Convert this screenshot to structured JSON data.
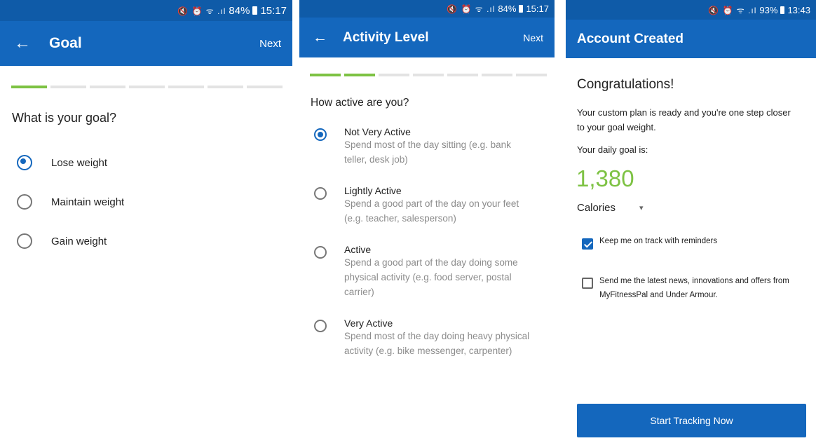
{
  "screen1": {
    "status": {
      "icons": "🔇 ⏰ ᯤ .ıl",
      "battery": "84%",
      "time": "15:17"
    },
    "appbar": {
      "back_icon": "←",
      "title": "Goal",
      "next": "Next"
    },
    "progress_total": 7,
    "progress_done": 1,
    "question": "What is your goal?",
    "options": [
      {
        "label": "Lose weight",
        "selected": true
      },
      {
        "label": "Maintain weight",
        "selected": false
      },
      {
        "label": "Gain weight",
        "selected": false
      }
    ]
  },
  "screen2": {
    "status": {
      "icons": "🔇 ⏰ ᯤ .ıl",
      "battery": "84%",
      "time": "15:17"
    },
    "appbar": {
      "back_icon": "←",
      "title": "Activity Level",
      "next": "Next"
    },
    "progress_total": 7,
    "progress_done": 2,
    "question": "How active are you?",
    "options": [
      {
        "label": "Not Very Active",
        "desc1": "Spend most of the day sitting (e.g. bank",
        "desc2": "teller, desk job)",
        "desc3": "",
        "selected": true
      },
      {
        "label": "Lightly Active",
        "desc1": "Spend a good part of the day on your feet",
        "desc2": "(e.g. teacher, salesperson)",
        "desc3": "",
        "selected": false
      },
      {
        "label": "Active",
        "desc1": "Spend a good part of the day doing some",
        "desc2": "physical activity (e.g. food server, postal",
        "desc3": "carrier)",
        "selected": false
      },
      {
        "label": "Very Active",
        "desc1": "Spend most of the day doing heavy physical",
        "desc2": "activity (e.g. bike messenger, carpenter)",
        "desc3": "",
        "selected": false
      }
    ]
  },
  "screen3": {
    "status": {
      "icons": "🔇 ⏰ ᯤ .ıl",
      "battery": "93%",
      "time": "13:43"
    },
    "appbar": {
      "title": "Account Created"
    },
    "heading": "Congratulations!",
    "message1": "Your custom plan is ready and you're one step closer",
    "message2": "to your goal weight.",
    "daily_goal_label": "Your daily goal is:",
    "daily_goal_value": "1,380",
    "unit": "Calories",
    "unit_caret": "▾",
    "reminders": {
      "label": "Keep me on track with reminders",
      "checked": true
    },
    "news": {
      "label1": "Send me the latest news, innovations and offers from",
      "label2": "MyFitnessPal and Under Armour.",
      "checked": false
    },
    "cta": "Start Tracking Now",
    "colors": {
      "accent": "#1467bd",
      "goal_green": "#7dc243"
    }
  }
}
